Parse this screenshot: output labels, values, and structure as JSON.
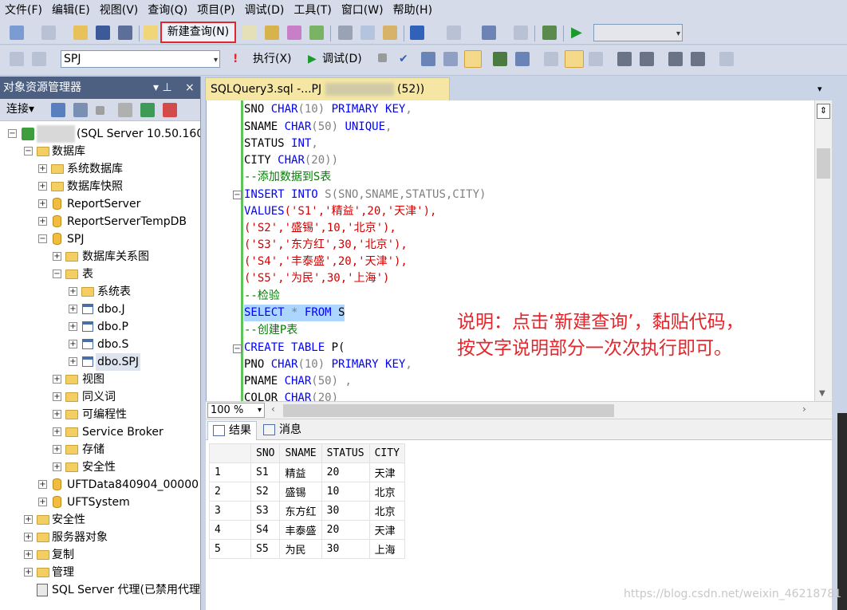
{
  "menu": [
    "文件(F)",
    "编辑(E)",
    "视图(V)",
    "查询(Q)",
    "项目(P)",
    "调试(D)",
    "工具(T)",
    "窗口(W)",
    "帮助(H)"
  ],
  "toolbar1": {
    "new_query": "新建查询(N)"
  },
  "toolbar2": {
    "database": "SPJ",
    "execute": "执行(X)",
    "debug": "调试(D)"
  },
  "explorer": {
    "title": "对象资源管理器",
    "pin": "▾ ⊥",
    "close": "×",
    "connect": "连接▾",
    "tree": [
      {
        "label": "(SQL Server 10.50.160"
      },
      {
        "label": "数据库"
      },
      {
        "label": "系统数据库"
      },
      {
        "label": "数据库快照"
      },
      {
        "label": "ReportServer"
      },
      {
        "label": "ReportServerTempDB"
      },
      {
        "label": "SPJ"
      },
      {
        "label": "数据库关系图"
      },
      {
        "label": "表"
      },
      {
        "label": "系统表"
      },
      {
        "label": "dbo.J"
      },
      {
        "label": "dbo.P"
      },
      {
        "label": "dbo.S"
      },
      {
        "label": "dbo.SPJ"
      },
      {
        "label": "视图"
      },
      {
        "label": "同义词"
      },
      {
        "label": "可编程性"
      },
      {
        "label": "Service Broker"
      },
      {
        "label": "存储"
      },
      {
        "label": "安全性"
      },
      {
        "label": "UFTData840904_00000"
      },
      {
        "label": "UFTSystem"
      },
      {
        "label": "安全性"
      },
      {
        "label": "服务器对象"
      },
      {
        "label": "复制"
      },
      {
        "label": "管理"
      },
      {
        "label": "SQL Server 代理(已禁用代理"
      }
    ]
  },
  "editor": {
    "tab_title": "SQLQuery3.sql -...PJ",
    "tab_suffix": "(52))",
    "zoom": "100 %",
    "note_line1": "说明：点击‘新建查询’，黏贴代码，",
    "note_line2": "按文字说明部分一次次执行即可。"
  },
  "code": [
    [
      "SNO ",
      "CHAR",
      "(10) ",
      "PRIMARY KEY",
      ","
    ],
    [
      "SNAME ",
      "CHAR",
      "(50) ",
      "UNIQUE",
      ","
    ],
    [
      "STATUS ",
      "INT",
      ","
    ],
    [
      "CITY ",
      "CHAR",
      "(20))"
    ],
    [
      "--添加数据到S表"
    ],
    [
      "INSERT",
      " ",
      "INTO",
      " S(SNO,SNAME,STATUS,CITY)"
    ],
    [
      "VALUES",
      "('S1','精益',20,'天津'),"
    ],
    [
      "('S2','盛锡',10,'北京'),"
    ],
    [
      "('S3','东方红',30,'北京'),"
    ],
    [
      "('S4','丰泰盛',20,'天津'),"
    ],
    [
      "('S5','为民',30,'上海')"
    ],
    [
      "--检验"
    ],
    [
      "SELECT",
      " ",
      "*",
      " ",
      "FROM",
      " S"
    ],
    [
      "--创建P表"
    ],
    [
      "CREATE",
      " ",
      "TABLE",
      " P("
    ],
    [
      "PNO ",
      "CHAR",
      "(10) ",
      "PRIMARY KEY",
      ","
    ],
    [
      "PNAME ",
      "CHAR",
      "(50) ",
      ","
    ],
    [
      "COLOR ",
      "CHAR",
      "(20)"
    ]
  ],
  "results": {
    "tab_results": "结果",
    "tab_messages": "消息",
    "columns": [
      "SNO",
      "SNAME",
      "STATUS",
      "CITY"
    ],
    "rows": [
      [
        "1",
        "S1",
        "精益",
        "20",
        "天津"
      ],
      [
        "2",
        "S2",
        "盛锡",
        "10",
        "北京"
      ],
      [
        "3",
        "S3",
        "东方红",
        "30",
        "北京"
      ],
      [
        "4",
        "S4",
        "丰泰盛",
        "20",
        "天津"
      ],
      [
        "5",
        "S5",
        "为民",
        "30",
        "上海"
      ]
    ]
  },
  "watermark": "https://blog.csdn.net/weixin_46218781"
}
